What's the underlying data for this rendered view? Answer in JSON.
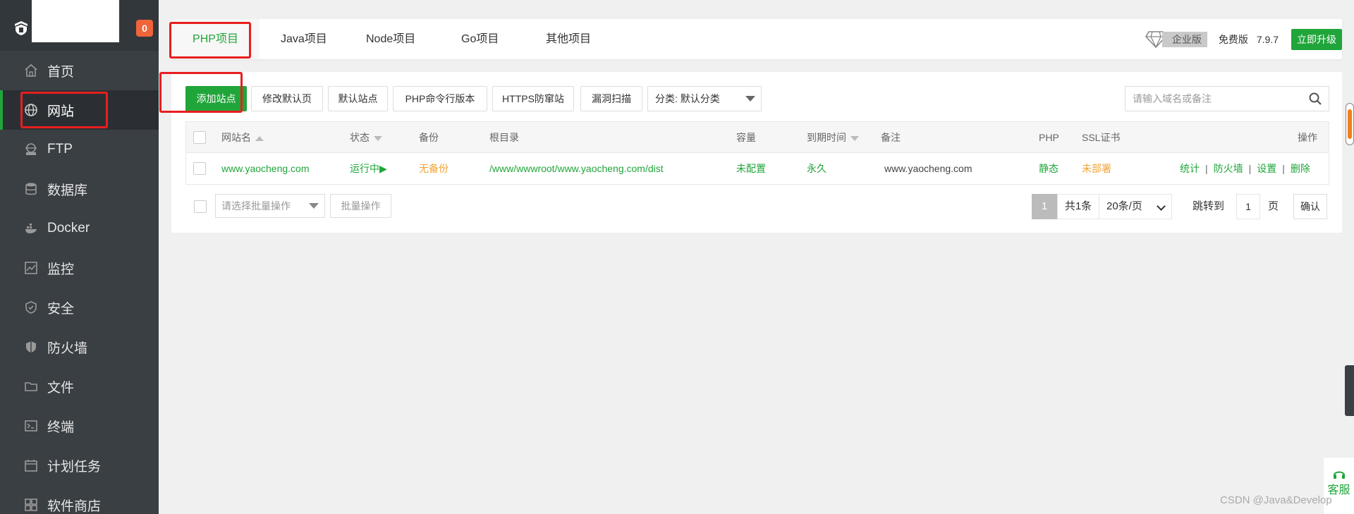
{
  "sidebar": {
    "notification_count": "0",
    "items": [
      {
        "label": "首页",
        "icon": "home-icon"
      },
      {
        "label": "网站",
        "icon": "globe-icon"
      },
      {
        "label": "FTP",
        "icon": "ftp-icon"
      },
      {
        "label": "数据库",
        "icon": "database-icon"
      },
      {
        "label": "Docker",
        "icon": "docker-icon"
      },
      {
        "label": "监控",
        "icon": "monitor-icon"
      },
      {
        "label": "安全",
        "icon": "shield-icon"
      },
      {
        "label": "防火墙",
        "icon": "firewall-icon"
      },
      {
        "label": "文件",
        "icon": "folder-icon"
      },
      {
        "label": "终端",
        "icon": "terminal-icon"
      },
      {
        "label": "计划任务",
        "icon": "calendar-icon"
      },
      {
        "label": "软件商店",
        "icon": "apps-icon"
      }
    ],
    "active_index": 1
  },
  "topbar": {
    "tabs": [
      "PHP项目",
      "Java项目",
      "Node项目",
      "Go项目",
      "其他项目"
    ],
    "active_tab": 0,
    "enterprise_label": "企业版",
    "edition_label": "免费版",
    "version": "7.9.7",
    "upgrade_label": "立即升级"
  },
  "toolbar": {
    "add_site": "添加站点",
    "modify_default_page": "修改默认页",
    "default_site": "默认站点",
    "php_cli_version": "PHP命令行版本",
    "https_protect": "HTTPS防窜站",
    "vuln_scan": "漏洞扫描",
    "category_select": "分类: 默认分类",
    "search_placeholder": "请输入域名或备注"
  },
  "table": {
    "headers": {
      "name": "网站名",
      "status": "状态",
      "backup": "备份",
      "root": "根目录",
      "capacity": "容量",
      "expire": "到期时间",
      "remark": "备注",
      "php": "PHP",
      "ssl": "SSL证书",
      "ops": "操作"
    },
    "rows": [
      {
        "name": "www.yaocheng.com",
        "status": "运行中▶",
        "backup": "无备份",
        "root": "/www/wwwroot/www.yaocheng.com/dist",
        "capacity": "未配置",
        "expire": "永久",
        "remark": "www.yaocheng.com",
        "php": "静态",
        "ssl": "未部署",
        "ops": [
          "统计",
          "防火墙",
          "设置",
          "删除"
        ]
      }
    ]
  },
  "footer": {
    "bulk_placeholder": "请选择批量操作",
    "bulk_button": "批量操作",
    "current_page": "1",
    "total": "共1条",
    "page_size": "20条/页",
    "jump_label": "跳转到",
    "jump_value": "1",
    "page_word": "页",
    "confirm": "确认"
  },
  "service_label": "客服",
  "watermark": "CSDN @Java&Develop",
  "colors": {
    "accent": "#20a53a",
    "warning": "#f0a336",
    "sidebar_bg": "#3a3f44",
    "annotation_red": "#e81e1e"
  }
}
